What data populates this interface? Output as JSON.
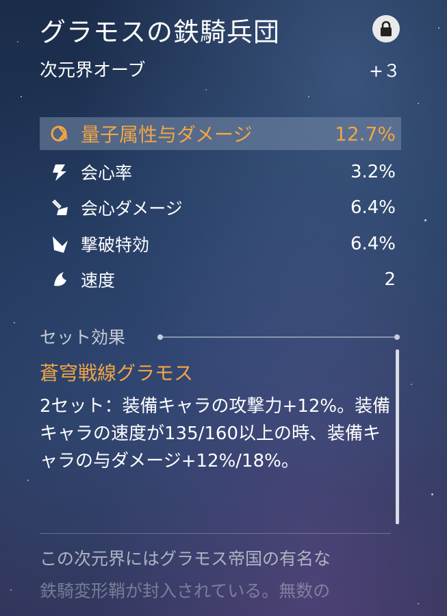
{
  "title": "グラモスの鉄騎兵団",
  "sub": {
    "name": "次元界オーブ",
    "level": "+３"
  },
  "main_stat": {
    "icon": "quantum-icon",
    "label": "量子属性与ダメージ",
    "value": "12.7%",
    "color": "#f2a545"
  },
  "sub_stats": [
    {
      "icon": "crit-rate-icon",
      "label": "会心率",
      "value": "3.2%"
    },
    {
      "icon": "crit-dmg-icon",
      "label": "会心ダメージ",
      "value": "6.4%"
    },
    {
      "icon": "break-effect-icon",
      "label": "撃破特効",
      "value": "6.4%"
    },
    {
      "icon": "speed-icon",
      "label": "速度",
      "value": "2"
    }
  ],
  "set_effect": {
    "heading": "セット効果",
    "name": "蒼穹戦線グラモス",
    "description": "2セット：装備キャラの攻撃力+12%。装備キャラの速度が135/160以上の時、装備キャラの与ダメージ+12%/18%。"
  },
  "lore": {
    "line1": "この次元界にはグラモス帝国の有名な",
    "line2": "鉄騎変形鞘が封入されている。無数の"
  },
  "colors": {
    "accent": "#f2a545",
    "text": "#ffffff",
    "muted": "#aeb4c2"
  }
}
